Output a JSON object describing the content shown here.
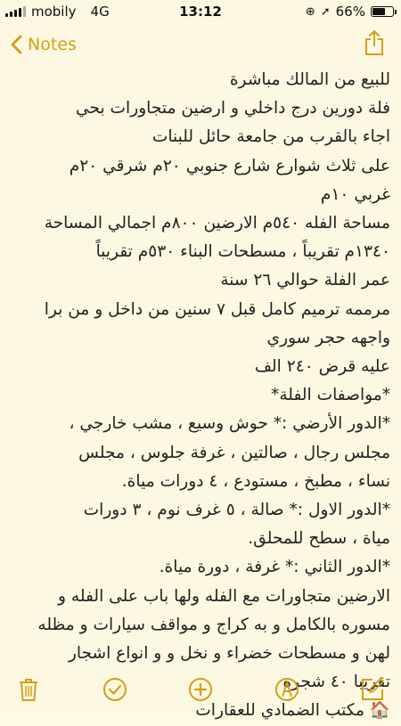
{
  "status_bar": {
    "carrier": "mobily",
    "network": "4G",
    "time": "13:12",
    "battery": "66%",
    "battery_level": 0.66
  },
  "nav": {
    "back_label": "Notes",
    "accent": "#d4a017"
  },
  "note": {
    "lines": [
      "للبيع من المالك مباشرة",
      "فلة دورين درج داخلي و ارضين متجاورات بحي",
      "اجاء بالقرب من جامعة حائل للبنات",
      "على ثلاث شوارع شارع جنوبي ٢٠م شرقي ٢٠م",
      "غربي ١٠م",
      "مساحة الفله ٥٤٠م الارضين ٨٠٠م اجمالي المساحة",
      "١٣٤٠م تقريباً ، مسطحات البناء ٥٣٠م تقريباً",
      "عمر الفلة حوالي ٢٦ سنة",
      "مرممه ترميم كامل قبل ٧ سنين من داخل و من برا",
      "واجهه حجر سوري",
      "عليه قرض ٢٤٠ الف",
      "*مواصفات الفلة*",
      "*الدور الأرضي :* حوش وسيع ، مشب خارجي ،",
      "مجلس رجال ، صالتين ، غرفة جلوس ، مجلس",
      "نساء ، مطبخ ، مستودع ، ٤ دورات مياة.",
      "*الدور الاول :* صالة ، ٥ غرف نوم ، ٣ دورات",
      "مياة ، سطح للمحلق.",
      "*الدور الثاني :* غرفة ، دورة مياة.",
      "الارضين متجاورات مع الفله ولها باب على الفله و",
      "مسوره بالكامل و به كراج و مواقف سيارات و مظله",
      "لهن و مسطحات خضراء و نخل و و انواع اشجار",
      "تقريبا ٤٠ شجرة",
      "🏠 مكتب الضمادي للعقارات"
    ]
  },
  "toolbar": {
    "icons": [
      "trash-icon",
      "checklist-icon",
      "add-icon",
      "sketch-icon",
      "compose-icon"
    ]
  }
}
